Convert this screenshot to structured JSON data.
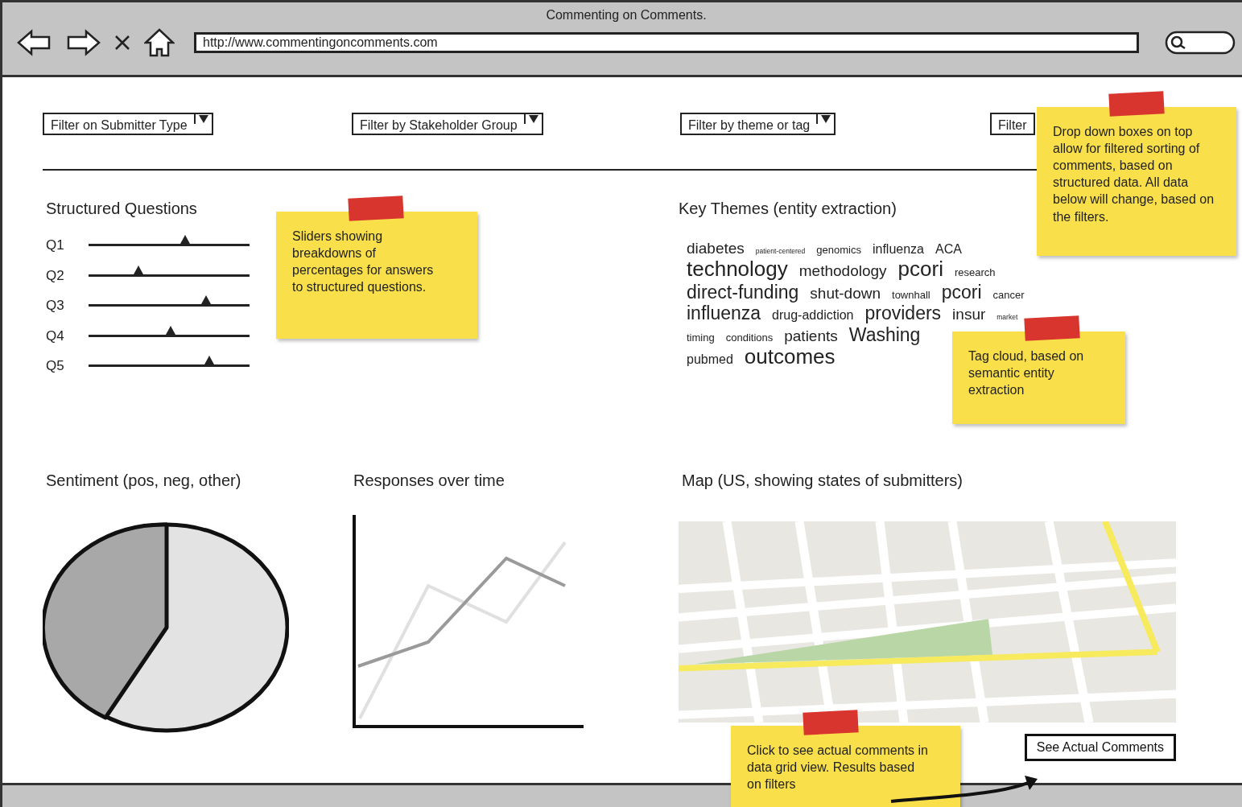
{
  "window": {
    "title": "Commenting on Comments.",
    "url": "http://www.commentingoncomments.com"
  },
  "filters": [
    {
      "label": "Filter on Submitter Type",
      "kind": "dropdown"
    },
    {
      "label": "Filter by Stakeholder Group",
      "kind": "dropdown"
    },
    {
      "label": "Filter by theme or tag",
      "kind": "dropdown"
    },
    {
      "label": "Filter",
      "kind": "partial"
    }
  ],
  "structured_questions": {
    "title": "Structured Questions",
    "questions": [
      {
        "label": "Q1",
        "level": 0.6
      },
      {
        "label": "Q2",
        "level": 0.31
      },
      {
        "label": "Q3",
        "level": 0.73
      },
      {
        "label": "Q4",
        "level": 0.51
      },
      {
        "label": "Q5",
        "level": 0.75
      }
    ]
  },
  "key_themes": {
    "title": "Key Themes (entity extraction)",
    "rows": [
      [
        {
          "text": "diabetes",
          "kind": "m"
        },
        {
          "text": "patient-centered",
          "kind": "xxs"
        },
        {
          "text": "genomics",
          "kind": "xs"
        },
        {
          "text": "influenza",
          "kind": "s"
        },
        {
          "text": "ACA",
          "kind": "s"
        }
      ],
      [
        {
          "text": "technology",
          "kind": "xl"
        },
        {
          "text": "methodology",
          "kind": "m"
        },
        {
          "text": "pcori",
          "kind": "xl"
        },
        {
          "text": "research",
          "kind": "xs"
        }
      ],
      [
        {
          "text": "direct-funding",
          "kind": "l"
        },
        {
          "text": "shut-down",
          "kind": "m"
        },
        {
          "text": "townhall",
          "kind": "xs"
        },
        {
          "text": "pcori",
          "kind": "l"
        },
        {
          "text": "cancer",
          "kind": "xs"
        }
      ],
      [
        {
          "text": "influenza",
          "kind": "l"
        },
        {
          "text": "drug-addiction",
          "kind": "s"
        },
        {
          "text": "providers",
          "kind": "l"
        },
        {
          "text": "insur",
          "kind": "m"
        },
        {
          "text": "market",
          "kind": "xxs"
        }
      ],
      [
        {
          "text": "timing",
          "kind": "xs"
        },
        {
          "text": "conditions",
          "kind": "xs"
        },
        {
          "text": "patients",
          "kind": "m"
        },
        {
          "text": "Washing",
          "kind": "l"
        }
      ],
      [
        {
          "text": "pubmed",
          "kind": "s"
        },
        {
          "text": "outcomes",
          "kind": "xl"
        }
      ]
    ]
  },
  "sentiment": {
    "title": "Sentiment (pos, neg, other)"
  },
  "responses": {
    "title": "Responses over time"
  },
  "map": {
    "title": "Map (US, showing states of submitters)"
  },
  "action_button": {
    "label": "See Actual Comments"
  },
  "notes": [
    {
      "text": "Sliders showing breakdowns of percentages for answers to structured questions."
    },
    {
      "text": "Drop down boxes on top allow for filtered sorting of comments, based on structured data. All data below will change, based on the filters."
    },
    {
      "text": "Tag cloud, based on semantic entity extraction"
    },
    {
      "text": "Click to see actual comments in data grid view. Results based on filters"
    }
  ]
}
